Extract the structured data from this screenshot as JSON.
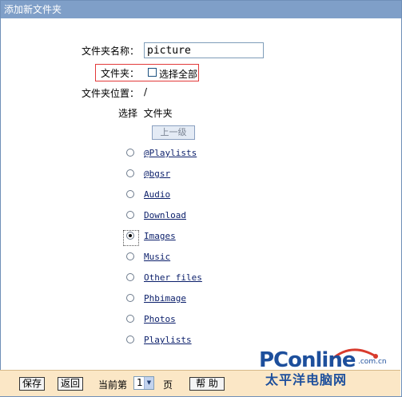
{
  "window": {
    "title": "添加新文件夹"
  },
  "form": {
    "name_label": "文件夹名称：",
    "name_value": "picture",
    "folder_label": "文件夹：",
    "select_all_label": "选择全部",
    "location_label": "文件夹位置：",
    "location_value": "/",
    "select_header": "选择  文件夹",
    "up_button_label": "上一级"
  },
  "folders": [
    {
      "name": "@Playlists",
      "selected": false
    },
    {
      "name": "@bgsr",
      "selected": false
    },
    {
      "name": "Audio",
      "selected": false
    },
    {
      "name": "Download",
      "selected": false
    },
    {
      "name": "Images",
      "selected": true
    },
    {
      "name": "Music",
      "selected": false
    },
    {
      "name": "Other files",
      "selected": false
    },
    {
      "name": "Phbimage",
      "selected": false
    },
    {
      "name": "Photos",
      "selected": false
    },
    {
      "name": "Playlists",
      "selected": false
    }
  ],
  "bottom_bar": {
    "save_label": "保存",
    "back_label": "返回",
    "current_page_label": "当前第",
    "page_value": "1",
    "page_suffix": "页",
    "help_label": "帮 助"
  },
  "watermark": {
    "brand": "PConline",
    "domain": ".com.cn",
    "tagline": "太平洋电脑网"
  },
  "colors": {
    "title_bar": "#7f9fc8",
    "bottom_bar": "#fbe7c6",
    "highlight_border": "#e23a3a",
    "link": "#0b1f6b",
    "watermark_blue": "#1d4f9c",
    "watermark_red": "#d83a2c"
  }
}
